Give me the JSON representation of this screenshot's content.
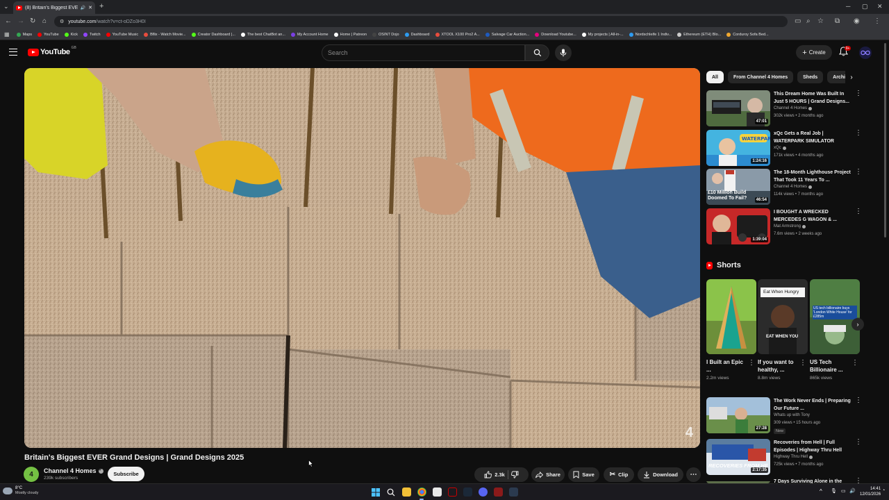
{
  "browser": {
    "tab_title": "(8) Britain's Biggest EVER G",
    "url_host": "youtube.com",
    "url_path": "/watch?v=ct-oDZo3H0I",
    "new_tab_symbol": "+"
  },
  "bookmarks": [
    {
      "label": "Maps",
      "color": "#34a853"
    },
    {
      "label": "YouTube",
      "color": "#ff0000"
    },
    {
      "label": "Kick",
      "color": "#53fc18"
    },
    {
      "label": "Twitch",
      "color": "#9146ff"
    },
    {
      "label": "YouTube Music",
      "color": "#ff0000"
    },
    {
      "label": "Bflix - Watch Movie...",
      "color": "#e84c3d"
    },
    {
      "label": "Creator Dashboard |...",
      "color": "#53fc18"
    },
    {
      "label": "The best ChatBot an...",
      "color": "#ffffff"
    },
    {
      "label": "My Account Home",
      "color": "#7b3fe4"
    },
    {
      "label": "Home | Patreon",
      "color": "#ffffff"
    },
    {
      "label": "OSINT Dojo",
      "color": "#444444"
    },
    {
      "label": "Dashboard",
      "color": "#2d9bf0"
    },
    {
      "label": "XTOOL X100 Pro2 A...",
      "color": "#e84c3d"
    },
    {
      "label": "Salvage Car Auction...",
      "color": "#1e5bbf"
    },
    {
      "label": "Download Youtube...",
      "color": "#e6007e"
    },
    {
      "label": "My projects | All-in-...",
      "color": "#ffffff"
    },
    {
      "label": "Nordschleife 1 Indiv...",
      "color": "#2d9bf0"
    },
    {
      "label": "Ethereum (ETH) Blo...",
      "color": "#cccccc"
    },
    {
      "label": "Corduroy Sofa Bed...",
      "color": "#f0a830"
    }
  ],
  "header": {
    "logo_text": "YouTube",
    "logo_country": "GB",
    "search_placeholder": "Search",
    "create_label": "Create",
    "notif_count": "9+"
  },
  "video": {
    "title": "Britain's Biggest EVER Grand Designs | Grand Designs 2025",
    "channel_name": "Channel 4 Homes",
    "channel_subs": "239k subscribers",
    "channel_avatar_text": "4",
    "watermark": "4",
    "subscribe_label": "Subscribe",
    "likes": "2.3k",
    "share_label": "Share",
    "save_label": "Save",
    "clip_label": "Clip",
    "download_label": "Download"
  },
  "sidebar": {
    "chips": [
      "All",
      "From Channel 4 Homes",
      "Sheds",
      "Archi"
    ],
    "recs": [
      {
        "title": "This Dream Home Was Built In Just 5 HOURS | Grand Designs...",
        "channel": "Channel 4 Homes",
        "verified": true,
        "meta": "302k views • 2 months ago",
        "duration": "47:01"
      },
      {
        "title": "xQc Gets a Real Job | WATERPARK SIMULATOR",
        "channel": "xQc",
        "verified": true,
        "meta": "171k views • 4 months ago",
        "duration": "1:24:16"
      },
      {
        "title": "The 18-Month Lighthouse Project That Took 11 Years To ...",
        "channel": "Channel 4 Homes",
        "verified": true,
        "meta": "114k views • 7 months ago",
        "duration": "46:54",
        "thumb_text": "£10 Million Build Doomed To Fail?"
      },
      {
        "title": "I BOUGHT A WRECKED MERCEDES G WAGON & ...",
        "channel": "Mat Armstrong",
        "verified": true,
        "meta": "7.6m views • 2 weeks ago",
        "duration": "1:39:04"
      }
    ],
    "shorts_heading": "Shorts",
    "shorts": [
      {
        "title": "I Built an Epic ...",
        "views": "2.2m views"
      },
      {
        "title": "If you want to healthy, ...",
        "views": "8.8m views",
        "thumb_top": "Eat When Hungry",
        "thumb_bottom": "EAT WHEN YOU"
      },
      {
        "title": "US Tech Billionaire ...",
        "views": "865k views",
        "thumb_text": "US tech billionaire buys 'London White House' for £285m"
      }
    ],
    "recs2": [
      {
        "title": "The Work Never Ends | Preparing Our Future ...",
        "channel": "Whats up with Tony",
        "verified": false,
        "meta": "309 views • 15 hours ago",
        "duration": "27:28",
        "badge": "New"
      },
      {
        "title": "Recoveries from Hell | Full Episodes | Highway Thru Hell",
        "channel": "Highway Thru Hell",
        "verified": true,
        "meta": "725k views • 7 months ago",
        "duration": "2:17:35",
        "thumb_text": "RECOVERIES FROM HE"
      },
      {
        "title": "7 Days Surviving Alone in the",
        "channel": "",
        "verified": false,
        "meta": "",
        "duration": ""
      }
    ]
  },
  "taskbar": {
    "temp": "8°C",
    "weather": "Mostly cloudy",
    "time": "14:41",
    "date": "12/01/2026"
  }
}
